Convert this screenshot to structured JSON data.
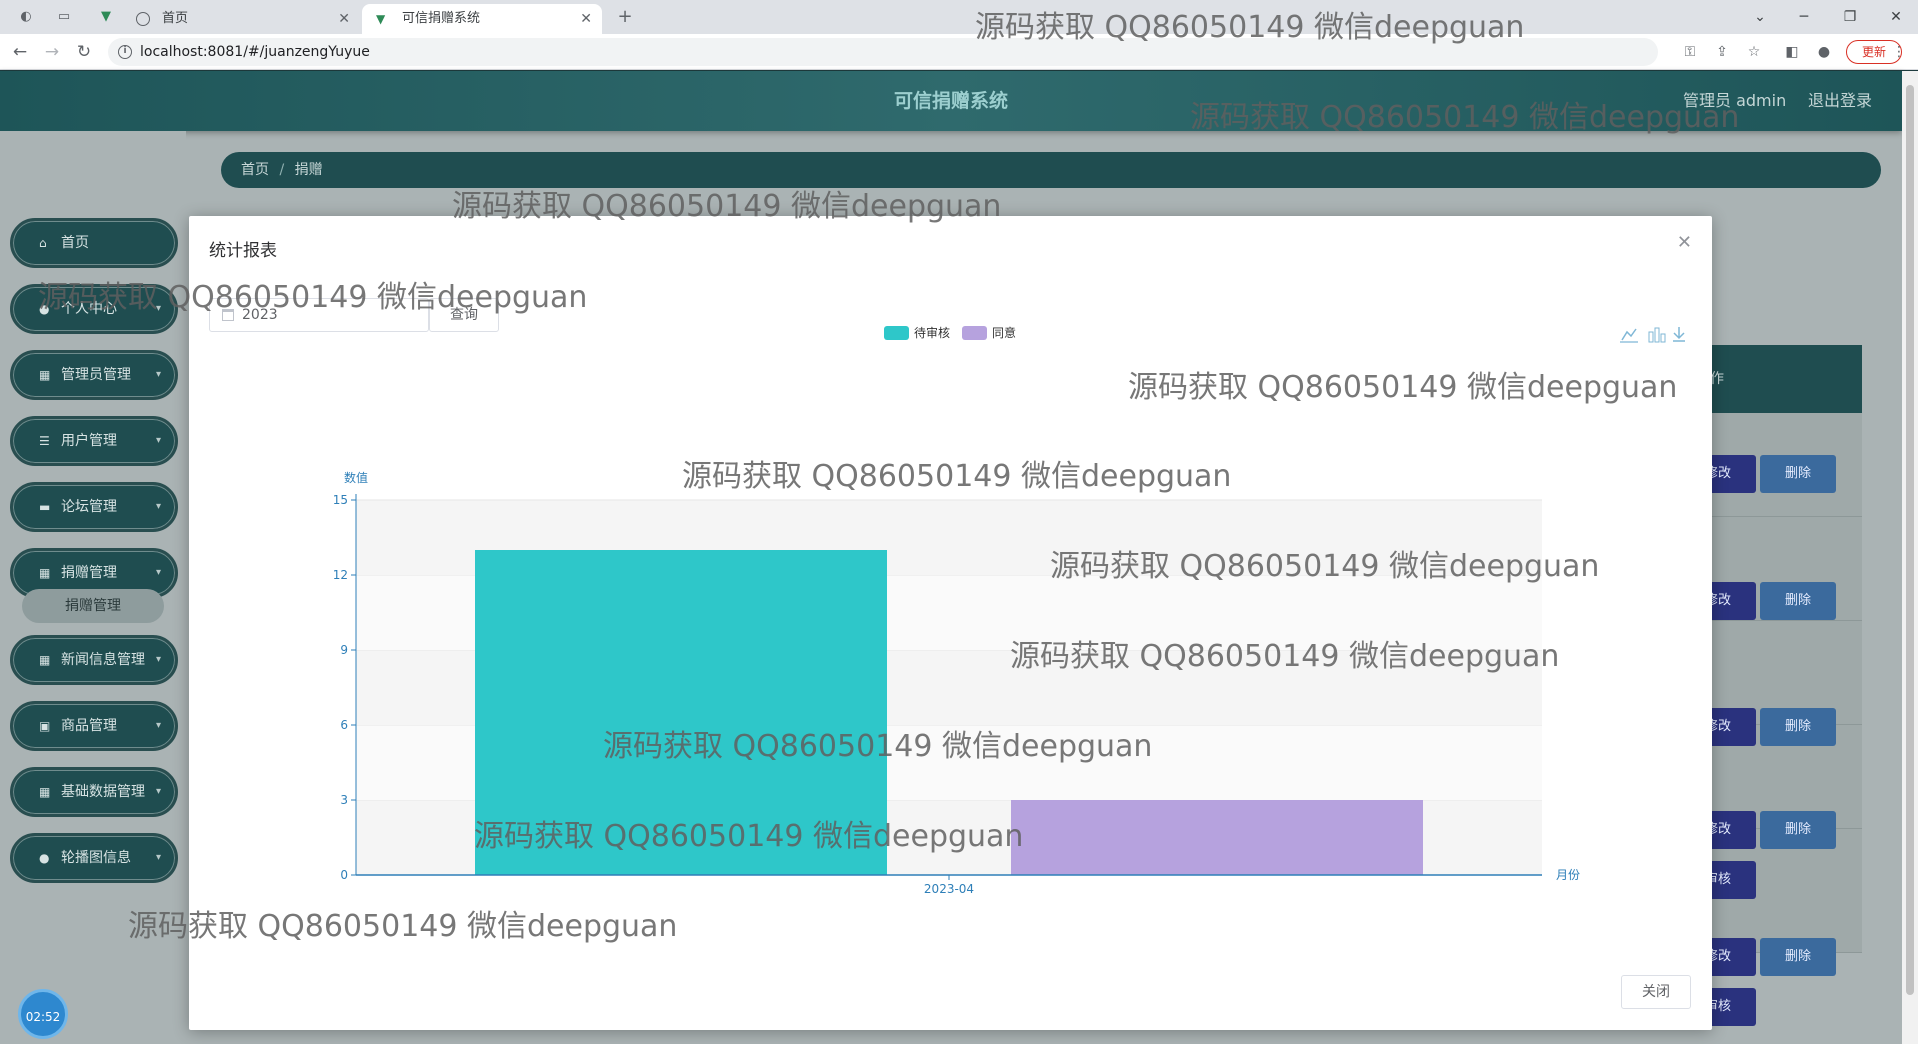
{
  "browser": {
    "tabs": [
      {
        "title": "首页"
      },
      {
        "title": "可信捐赠系统"
      }
    ],
    "url": "localhost:8081/#/juanzengYuyue",
    "update_label": "更新"
  },
  "app": {
    "title": "可信捐赠系统",
    "admin_label": "管理员 admin",
    "logout_label": "退出登录",
    "breadcrumb": [
      "首页",
      "捐赠"
    ],
    "timer": "02:52"
  },
  "sidebar": {
    "items": [
      {
        "icon": "home-icon",
        "label": "首页",
        "has_arrow": false
      },
      {
        "icon": "user-icon",
        "label": "个人中心",
        "has_arrow": true
      },
      {
        "icon": "grid-icon",
        "label": "管理员管理",
        "has_arrow": true
      },
      {
        "icon": "list-icon",
        "label": "用户管理",
        "has_arrow": true
      },
      {
        "icon": "comment-icon",
        "label": "论坛管理",
        "has_arrow": true
      },
      {
        "icon": "grid-icon",
        "label": "捐赠管理",
        "has_arrow": true
      },
      {
        "icon": "grid-icon",
        "label": "新闻信息管理",
        "has_arrow": true
      },
      {
        "icon": "bag-icon",
        "label": "商品管理",
        "has_arrow": true
      },
      {
        "icon": "grid-icon",
        "label": "基础数据管理",
        "has_arrow": true
      },
      {
        "icon": "user-icon",
        "label": "轮播图信息",
        "has_arrow": true
      }
    ],
    "submenu_active": "捐赠管理"
  },
  "table_partial": {
    "head_label": "作",
    "edit_label": "修改",
    "delete_label": "删除",
    "audit_label": "审核"
  },
  "modal": {
    "title": "统计报表",
    "year_value": "2023",
    "query_label": "查询",
    "close_label": "关闭"
  },
  "chart_data": {
    "type": "bar",
    "categories": [
      "2023-04"
    ],
    "series": [
      {
        "name": "待审核",
        "values": [
          13
        ],
        "color": "#2ec7c9"
      },
      {
        "name": "同意",
        "values": [
          3
        ],
        "color": "#b6a2de"
      }
    ],
    "xlabel": "月份",
    "ylabel": "数值",
    "ylim": [
      0,
      15
    ],
    "yticks": [
      0,
      3,
      6,
      9,
      12,
      15
    ],
    "legend_position": "top-center",
    "toolbox_icons": [
      "line-chart-icon",
      "bar-chart-icon",
      "download-icon"
    ]
  },
  "watermark_text": "源码获取 QQ86050149 微信deepguan"
}
